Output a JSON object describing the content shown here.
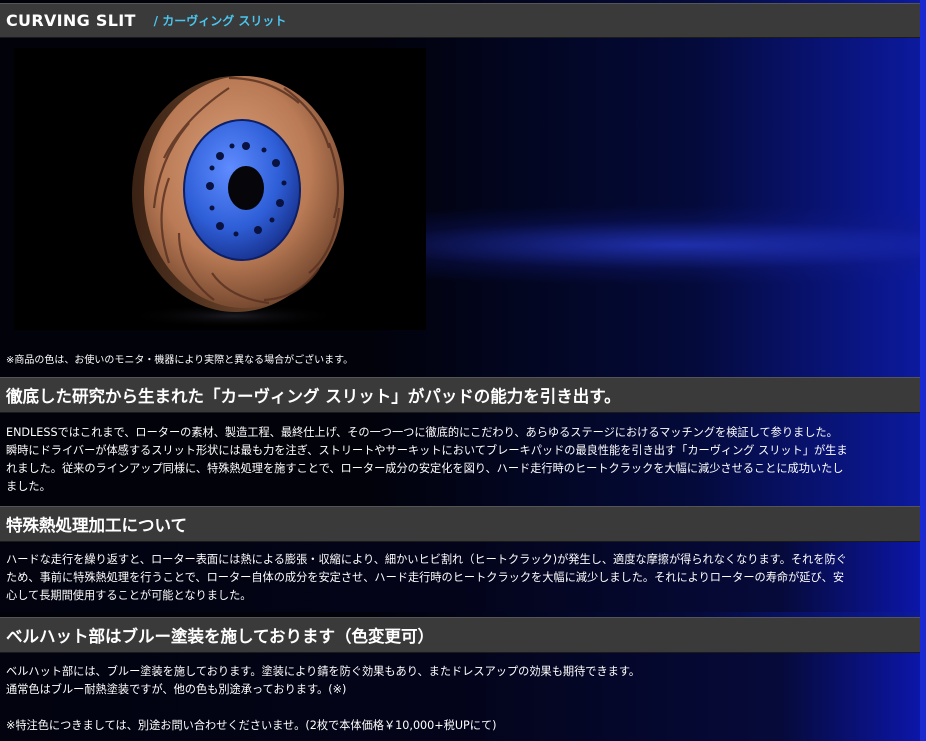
{
  "header": {
    "title": "CURVING SLIT",
    "subtitle": "/ カーヴィング スリット"
  },
  "product_image": {
    "icon": "brake-rotor-image",
    "rotor_color": "#b97a55",
    "hat_color": "#2f5fd8"
  },
  "photo_note": "※商品の色は、お使いのモニタ・機器により実際と異なる場合がございます。",
  "section1": {
    "heading": "徹底した研究から生まれた「カーヴィング スリット」がパッドの能力を引き出す。",
    "lines": [
      "ENDLESSではこれまで、ローターの素材、製造工程、最終仕上げ、その一つ一つに徹底的にこだわり、あらゆるステージにおけるマッチングを検証して参りました。",
      "瞬時にドライバーが体感するスリット形状には最も力を注ぎ、ストリートやサーキットにおいてブレーキパッドの最良性能を引き出す「カーヴィング スリット」が生ま",
      "れました。従来のラインアップ同様に、特殊熱処理を施すことで、ローター成分の安定化を図り、ハード走行時のヒートクラックを大幅に減少させることに成功いたし",
      "ました。"
    ]
  },
  "section2": {
    "heading": "特殊熱処理加工について",
    "lines": [
      "ハードな走行を繰り返すと、ローター表面には熱による膨張・収縮により、細かいヒビ割れ（ヒートクラック)が発生し、適度な摩擦が得られなくなります。それを防ぐ",
      "ため、事前に特殊熱処理を行うことで、ローター自体の成分を安定させ、ハード走行時のヒートクラックを大幅に減少しました。それによりローターの寿命が延び、安",
      "心して長期間使用することが可能となりました。"
    ]
  },
  "section3": {
    "heading": "ベルハット部はブルー塗装を施しております（色変更可）",
    "lines": [
      "ベルハット部には、ブルー塗装を施しております。塗装により錆を防ぐ効果もあり、またドレスアップの効果も期待できます。",
      "通常色はブルー耐熱塗装ですが、他の色も別途承っております。(※)",
      "",
      "※特注色につきましては、別途お問い合わせくださいませ。(2枚で本体価格￥10,000+税UPにて)"
    ]
  },
  "colors": {
    "bar_bg": "#3a3a3a",
    "subtitle_accent": "#4ac6f0",
    "frame_blue": "#1a2ad0"
  }
}
